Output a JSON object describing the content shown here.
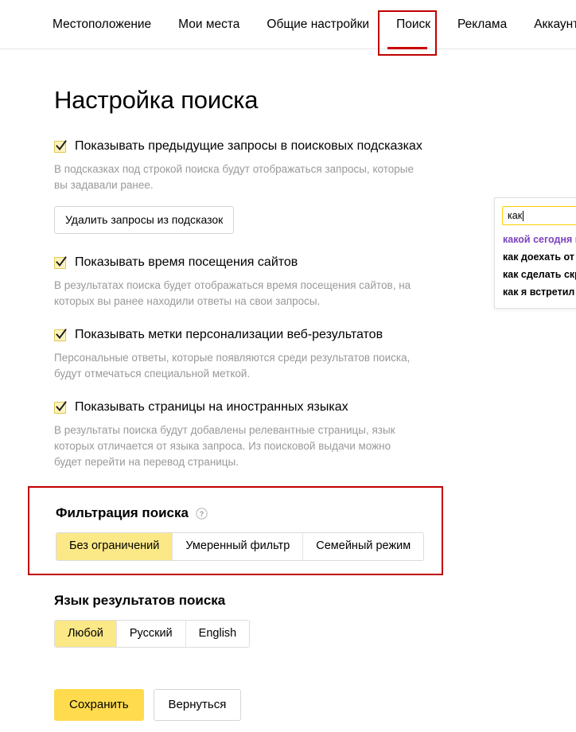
{
  "nav": {
    "items": [
      {
        "label": "Местоположение",
        "active": false
      },
      {
        "label": "Мои места",
        "active": false
      },
      {
        "label": "Общие настройки",
        "active": false
      },
      {
        "label": "Поиск",
        "active": true
      },
      {
        "label": "Реклама",
        "active": false
      },
      {
        "label": "Аккаунт",
        "active": false
      }
    ]
  },
  "page": {
    "title": "Настройка поиска"
  },
  "settings": [
    {
      "label": "Показывать предыдущие запросы в поисковых подсказках",
      "checked": true,
      "description": "В подсказках под строкой поиска будут отображаться запросы, которые вы задавали ранее.",
      "button": "Удалить запросы из подсказок"
    },
    {
      "label": "Показывать время посещения сайтов",
      "checked": true,
      "description": "В результатах поиска будет отображаться время посещения сайтов, на которых вы ранее находили ответы на свои запросы."
    },
    {
      "label": "Показывать метки персонализации веб-результатов",
      "checked": true,
      "description": "Персональные ответы, которые появляются среди результатов поиска, будут отмечаться специальной меткой."
    },
    {
      "label": "Показывать страницы на иностранных языках",
      "checked": true,
      "description": "В результаты поиска будут добавлены релевантные страницы, язык которых отличается от языка запроса. Из поисковой выдачи можно будет перейти на перевод страницы."
    }
  ],
  "suggest": {
    "query": "как",
    "items": [
      {
        "text": "какой сегодня п",
        "visited": true
      },
      {
        "text": "как доехать от",
        "visited": false
      },
      {
        "text": "как сделать скр",
        "visited": false
      },
      {
        "text": "как я встретил",
        "visited": false
      }
    ]
  },
  "filter": {
    "title": "Фильтрация поиска",
    "help_icon": "question-mark-icon",
    "options": [
      {
        "label": "Без ограничений",
        "selected": true
      },
      {
        "label": "Умеренный фильтр",
        "selected": false
      },
      {
        "label": "Семейный режим",
        "selected": false
      }
    ]
  },
  "language": {
    "title": "Язык результатов поиска",
    "options": [
      {
        "label": "Любой",
        "selected": true
      },
      {
        "label": "Русский",
        "selected": false
      },
      {
        "label": "English",
        "selected": false
      }
    ]
  },
  "actions": {
    "save": "Сохранить",
    "back": "Вернуться"
  },
  "colors": {
    "accent_yellow": "#ffdb4d",
    "selected_segment": "#fbe887",
    "annotation_red": "#c00000",
    "visited_link": "#7b42bd",
    "muted_text": "#999999"
  }
}
